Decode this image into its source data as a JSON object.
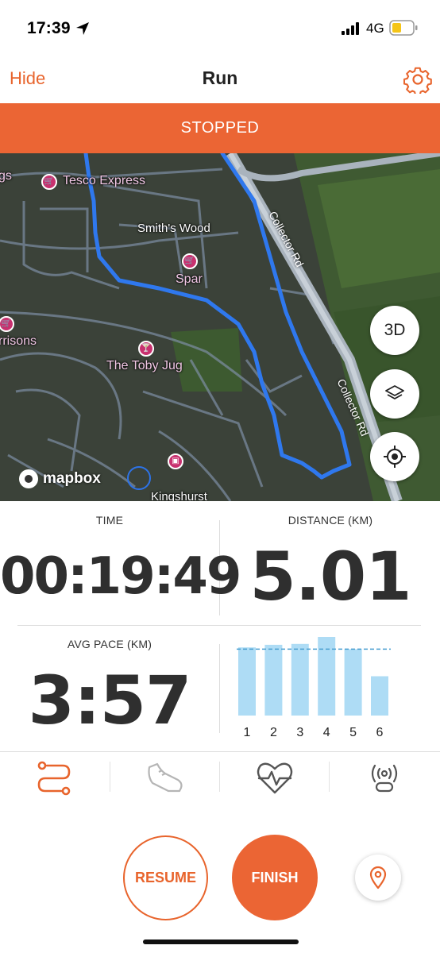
{
  "status_bar": {
    "time": "17:39",
    "network": "4G"
  },
  "header": {
    "hide_label": "Hide",
    "title": "Run"
  },
  "banner": {
    "state": "STOPPED"
  },
  "map": {
    "places": {
      "tesco": "Tesco Express",
      "smiths_wood": "Smith's Wood",
      "spar": "Spar",
      "arrisons": "rrisons",
      "toby_jug": "The Toby Jug",
      "kingshurst": "Kingshurst",
      "gs": "gs"
    },
    "road_name": "Collector Rd",
    "btn_3d": "3D",
    "attribution": "mapbox"
  },
  "stats": {
    "time_label": "TIME",
    "time_value": "00:19:49",
    "distance_label": "DISTANCE (KM)",
    "distance_value": "5.01",
    "pace_label": "AVG PACE (KM)",
    "pace_value": "3:57"
  },
  "chart_data": {
    "type": "bar",
    "categories": [
      "1",
      "2",
      "3",
      "4",
      "5",
      "6"
    ],
    "values": [
      0.78,
      0.81,
      0.82,
      0.9,
      0.76,
      0.45
    ],
    "reference_line": 0.76,
    "ylim": [
      0,
      1
    ],
    "bar_color": "#aedcf5",
    "line_color": "#4a9fd0"
  },
  "tabs": [
    {
      "icon": "route-icon",
      "active": true
    },
    {
      "icon": "shoe-icon",
      "active": false
    },
    {
      "icon": "heart-rate-icon",
      "active": false
    },
    {
      "icon": "sensor-icon",
      "active": false
    }
  ],
  "actions": {
    "resume": "RESUME",
    "finish": "FINISH"
  },
  "colors": {
    "accent": "#eb6534",
    "route": "#2f78ee"
  }
}
